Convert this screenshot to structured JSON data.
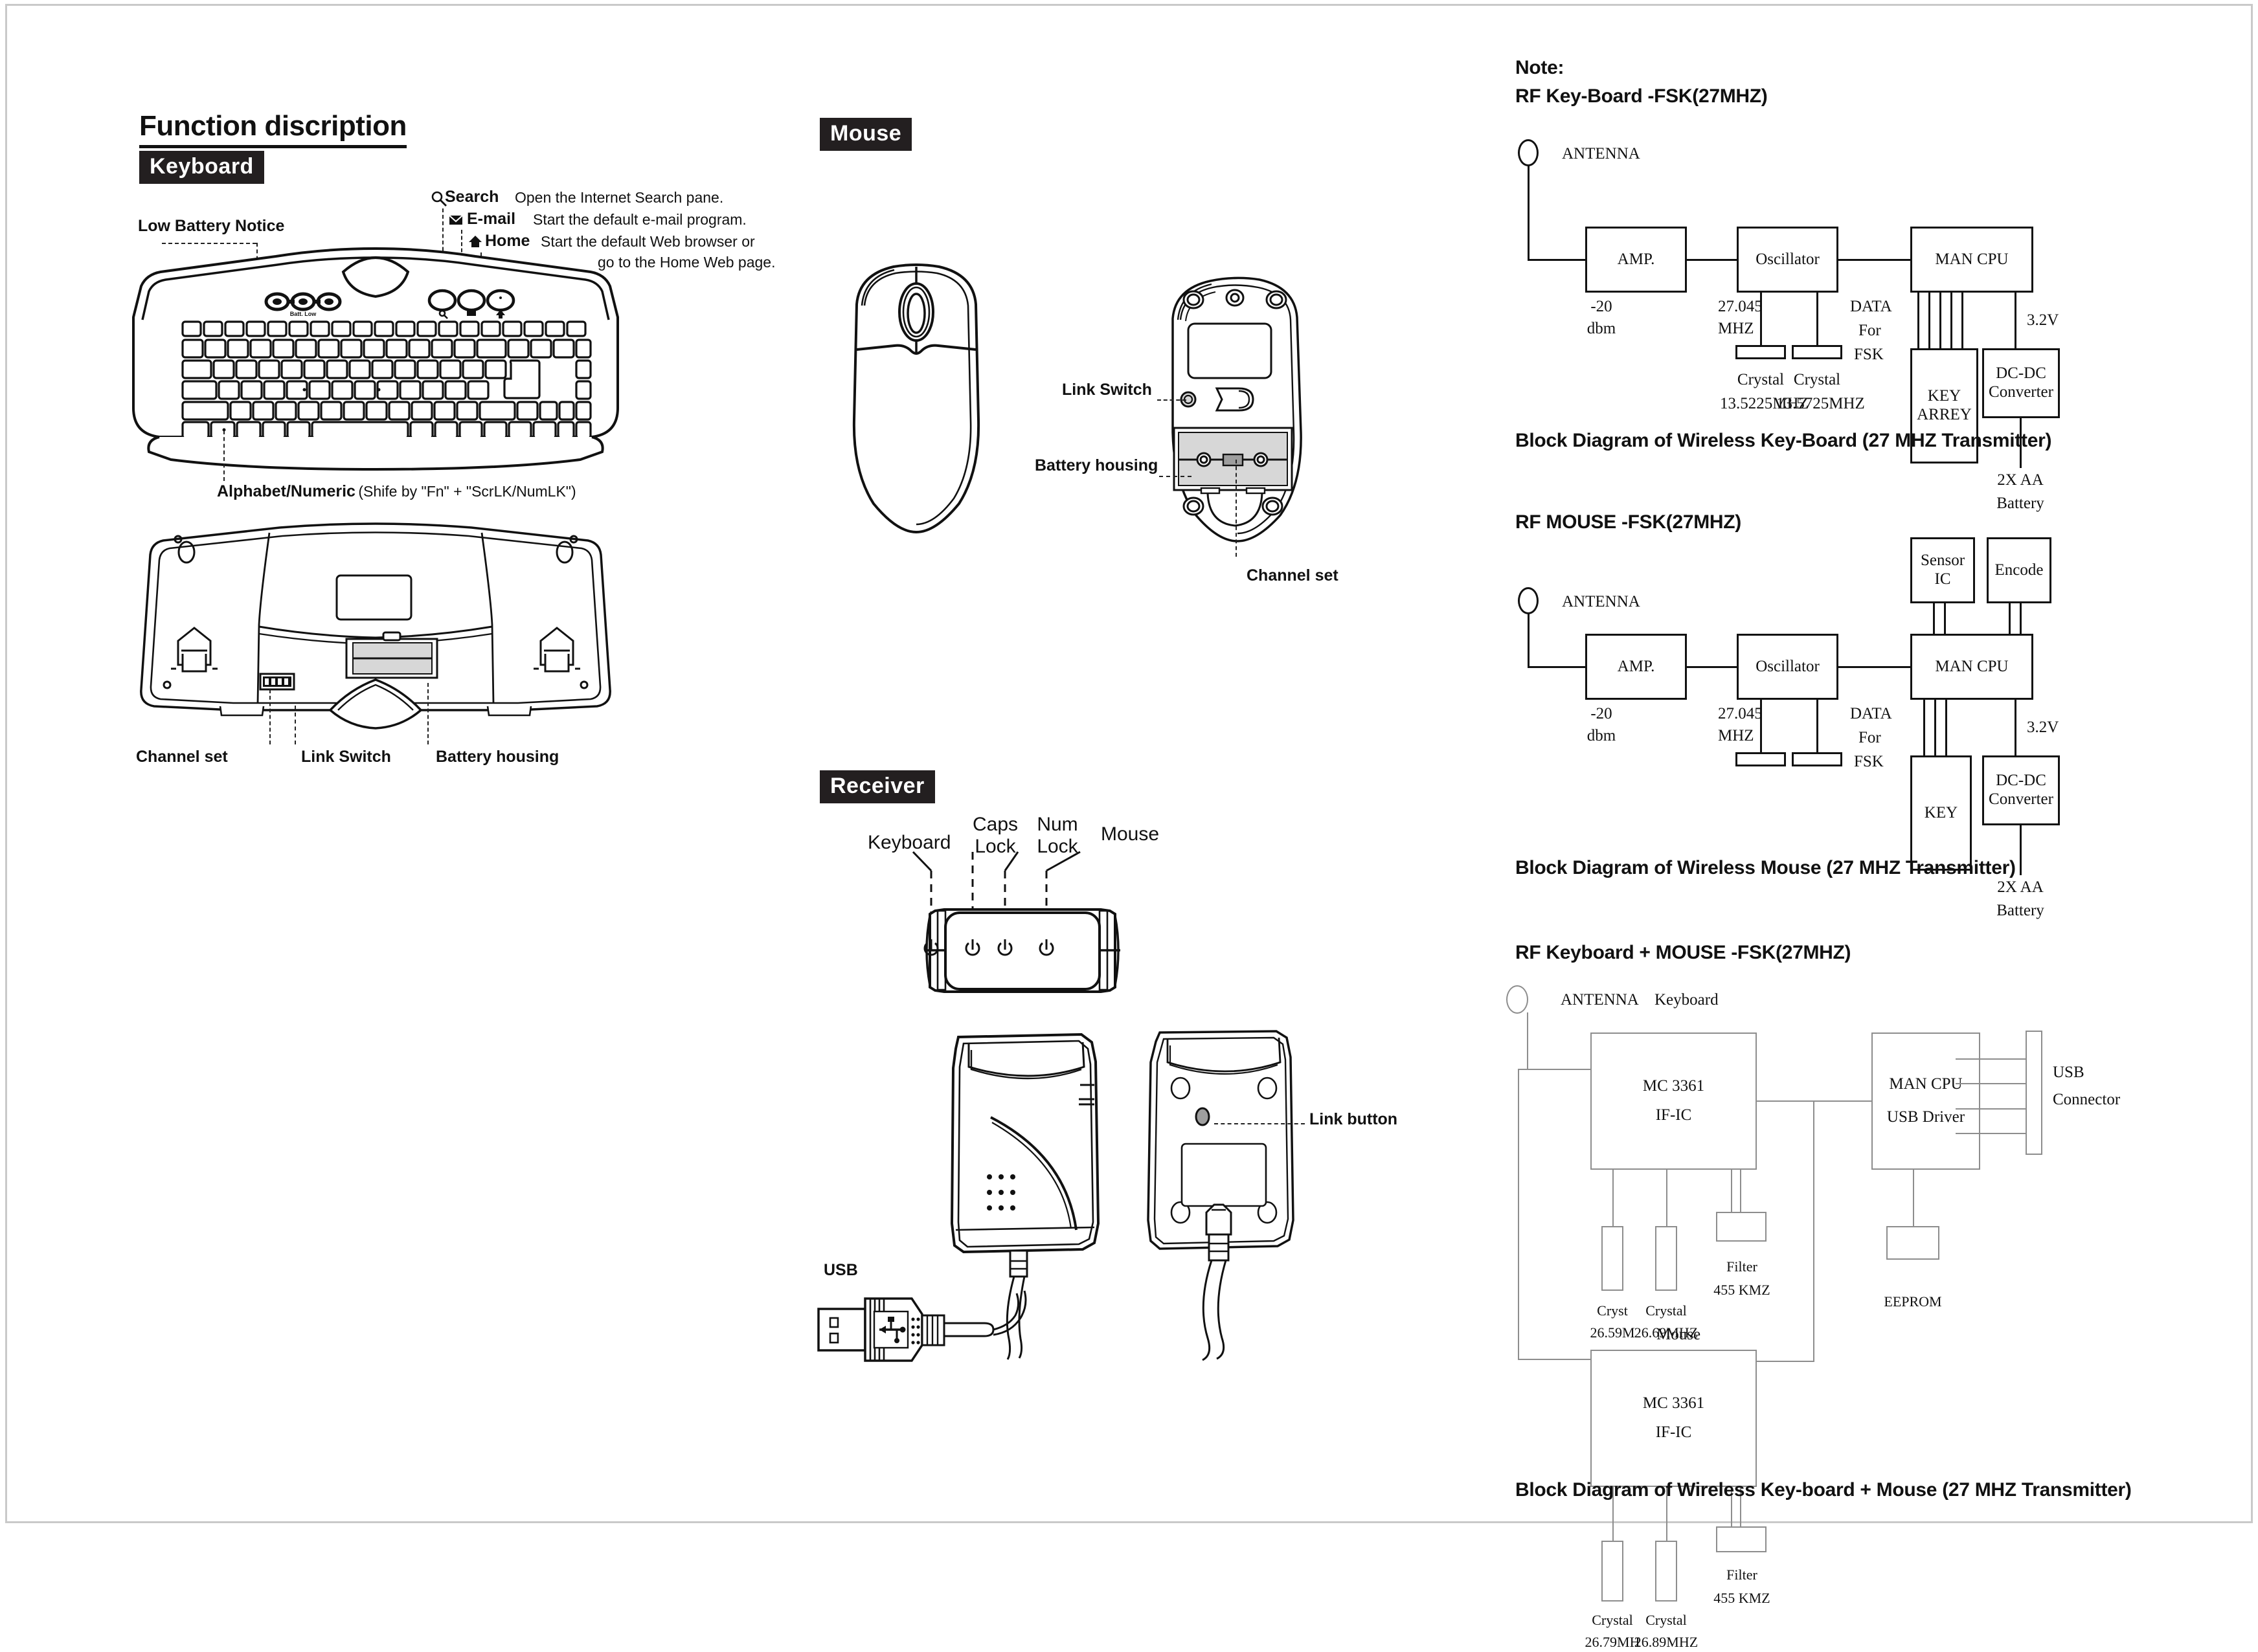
{
  "page": {
    "title": "Function discription"
  },
  "keyboard_section": {
    "tag": "Keyboard",
    "callouts": {
      "low_battery": "Low Battery Notice",
      "alphabet_numeric_bold": "Alphabet/Numeric",
      "alphabet_numeric_note": "(Shife by \"Fn\" + \"ScrLK/NumLK\")",
      "channel_set": "Channel  set",
      "link_switch": "Link Switch",
      "battery_housing": "Battery housing"
    },
    "hotkeys": [
      {
        "icon": "search-icon",
        "name": "Search",
        "desc": "Open the Internet Search pane."
      },
      {
        "icon": "envelope-icon",
        "name": "E-mail",
        "desc": "Start the default e-mail program."
      },
      {
        "icon": "home-icon",
        "name": "Home",
        "desc": "Start the default Web browser or",
        "desc2": "go to the Home Web page."
      }
    ],
    "led_label": "Batt. Low"
  },
  "mouse_section": {
    "tag": "Mouse",
    "callouts": {
      "link_switch": "Link Switch",
      "battery_housing": "Battery housing",
      "channel_set": "Channel set"
    }
  },
  "receiver_section": {
    "tag": "Receiver",
    "led_labels": [
      "Keyboard",
      "Caps\nLock",
      "Num\nLock",
      "Mouse"
    ],
    "led_labels_flat": [
      {
        "line1": "Keyboard",
        "line2": ""
      },
      {
        "line1": "Caps",
        "line2": "Lock"
      },
      {
        "line1": "Num",
        "line2": "Lock"
      },
      {
        "line1": "Mouse",
        "line2": ""
      }
    ],
    "callouts": {
      "link_button": "Link button",
      "usb": "USB"
    }
  },
  "note_label": "Note:",
  "diagrams": [
    {
      "id": "kb",
      "title": "RF Key-Board -FSK(27MHZ)",
      "caption": "Block Diagram of Wireless Key-Board (27 MHZ Transmitter)",
      "antenna_label": "ANTENNA",
      "labels": {
        "power": "-20",
        "power2": "dbm",
        "freq": "27.045",
        "freq2": "MHZ",
        "data": "DATA",
        "data2": "For",
        "data3": "FSK",
        "voltage": "3.2V",
        "battery": "2X AA",
        "battery2": "Battery"
      },
      "blocks": {
        "amp": "AMP.",
        "oscillator": "Oscillator",
        "cpu": "MAN CPU",
        "key": "KEY",
        "key2": "ARREY",
        "dcdc": "DC-DC",
        "dcdc2": "Converter"
      },
      "crystals": [
        {
          "name": "Crystal",
          "value": "13.5225MHZ"
        },
        {
          "name": "Crystal",
          "value": "13.5725MHZ"
        }
      ]
    },
    {
      "id": "mouse",
      "title": "RF MOUSE -FSK(27MHZ)",
      "caption": "Block Diagram of Wireless Mouse (27 MHZ Transmitter)",
      "antenna_label": "ANTENNA",
      "labels": {
        "power": "-20",
        "power2": "dbm",
        "freq": "27.045",
        "freq2": "MHZ",
        "data": "DATA",
        "data2": "For",
        "data3": "FSK",
        "voltage": "3.2V",
        "battery": "2X AA",
        "battery2": "Battery"
      },
      "blocks": {
        "sensor": "Sensor",
        "sensor2": "IC",
        "encode": "Encode",
        "amp": "AMP.",
        "oscillator": "Oscillator",
        "cpu": "MAN CPU",
        "key": "KEY",
        "dcdc": "DC-DC",
        "dcdc2": "Converter"
      },
      "crystals": [
        {
          "name": "",
          "value": ""
        },
        {
          "name": "",
          "value": ""
        }
      ]
    },
    {
      "id": "kbmouse",
      "title": "RF Keyboard + MOUSE -FSK(27MHZ)",
      "caption": "Block Diagram of Wireless Key-board + Mouse (27 MHZ Transmitter)",
      "antenna_label": "ANTENNA",
      "branch_kb": "Keyboard",
      "branch_mouse": "Mouse",
      "blocks": {
        "ific": "MC 3361",
        "ific2": "IF-IC",
        "cpu": "MAN CPU",
        "usbdrv": "USB Driver",
        "usbconn": "USB",
        "usbconn2": "Connector",
        "eeprom": "EEPROM"
      },
      "kb_parts": [
        {
          "name": "Cryst",
          "value": "26.59M"
        },
        {
          "name": "Crystal",
          "value": "26.69MHZ"
        },
        {
          "name": "Filter",
          "value": "455 KMZ"
        }
      ],
      "mouse_parts": [
        {
          "name": "Crystal",
          "value": "26.79MH"
        },
        {
          "name": "Crystal",
          "value": "26.89MHZ"
        },
        {
          "name": "Filter",
          "value": "455 KMZ"
        }
      ]
    }
  ],
  "colors": {
    "ink": "#111111",
    "tag_bg": "#231f20",
    "grey_line": "#8d8d8d",
    "shade": "#d7d7d7",
    "page_border": "#c9c9c9"
  }
}
